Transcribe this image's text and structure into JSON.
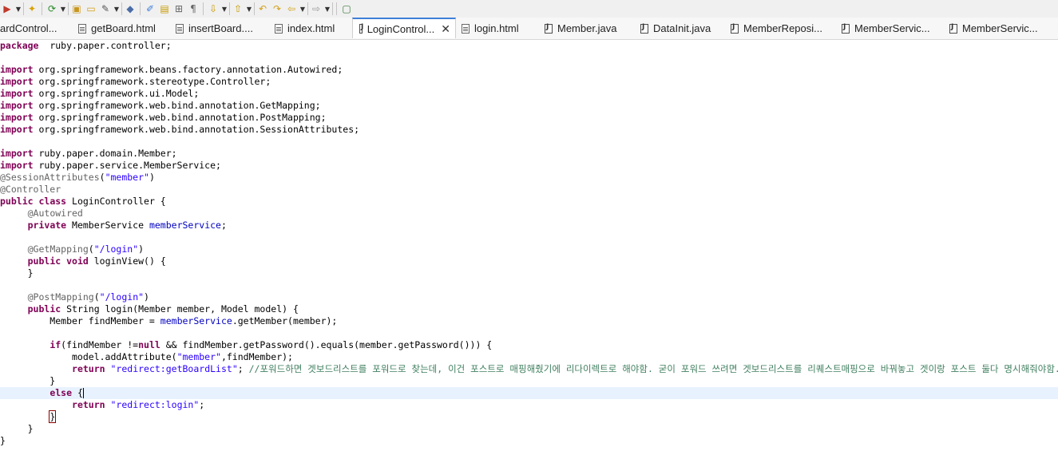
{
  "toolbar": {
    "buttons": [
      {
        "name": "run-icon",
        "glyph": "▶",
        "color": "#c0392b"
      },
      {
        "name": "package-icon",
        "glyph": "✦",
        "color": "#d9a000"
      },
      {
        "name": "refresh-icon",
        "glyph": "⟳",
        "color": "#2a8a2a"
      },
      {
        "name": "open-folder-icon",
        "glyph": "▣",
        "color": "#c8961e"
      },
      {
        "name": "folder-icon",
        "glyph": "▭",
        "color": "#d4a017"
      },
      {
        "name": "wand-icon",
        "glyph": "✎",
        "color": "#555555"
      },
      {
        "name": "toggle-mark-icon",
        "glyph": "◆",
        "color": "#4a6da7"
      },
      {
        "name": "highlight-icon",
        "glyph": "✐",
        "color": "#3f7fd8"
      },
      {
        "name": "block-selection-icon",
        "glyph": "▤",
        "color": "#c89b00"
      },
      {
        "name": "show-whitespace-icon",
        "glyph": "⊞",
        "color": "#666666"
      },
      {
        "name": "paragraph-icon",
        "glyph": "¶",
        "color": "#666666"
      },
      {
        "name": "next-annotation-icon",
        "glyph": "⇩",
        "color": "#c89b00"
      },
      {
        "name": "prev-annotation-icon",
        "glyph": "⇧",
        "color": "#c89b00"
      },
      {
        "name": "last-edit-icon",
        "glyph": "↶",
        "color": "#d4a017"
      },
      {
        "name": "last-edit-forward-icon",
        "glyph": "↷",
        "color": "#d4a017"
      },
      {
        "name": "back-icon",
        "glyph": "⇦",
        "color": "#d4a017"
      },
      {
        "name": "forward-icon",
        "glyph": "⇨",
        "color": "#999999"
      },
      {
        "name": "maximize-icon",
        "glyph": "▢",
        "color": "#3a7a3a"
      }
    ]
  },
  "tabs": [
    {
      "label": "ardControl...",
      "icon": "java",
      "active": false
    },
    {
      "label": "getBoard.html",
      "icon": "html",
      "active": false
    },
    {
      "label": "insertBoard....",
      "icon": "html",
      "active": false
    },
    {
      "label": "index.html",
      "icon": "html",
      "active": false
    },
    {
      "label": "LoginControl...",
      "icon": "java",
      "active": true,
      "close": "✕"
    },
    {
      "label": "login.html",
      "icon": "html",
      "active": false
    },
    {
      "label": "Member.java",
      "icon": "java",
      "active": false
    },
    {
      "label": "DataInit.java",
      "icon": "java",
      "active": false
    },
    {
      "label": "MemberReposi...",
      "icon": "java",
      "active": false
    },
    {
      "label": "MemberServic...",
      "icon": "java",
      "active": false
    },
    {
      "label": "MemberServic...",
      "icon": "java",
      "active": false
    }
  ],
  "code": [
    [
      [
        "kw",
        "package"
      ],
      [
        "",
        "  ruby.paper.controller;"
      ]
    ],
    [],
    [
      [
        "kw",
        "import"
      ],
      [
        "",
        " org.springframework.beans.factory.annotation.Autowired;"
      ]
    ],
    [
      [
        "kw",
        "import"
      ],
      [
        "",
        " org.springframework.stereotype.Controller;"
      ]
    ],
    [
      [
        "kw",
        "import"
      ],
      [
        "",
        " org.springframework.ui.Model;"
      ]
    ],
    [
      [
        "kw",
        "import"
      ],
      [
        "",
        " org.springframework.web.bind.annotation.GetMapping;"
      ]
    ],
    [
      [
        "kw",
        "import"
      ],
      [
        "",
        " org.springframework.web.bind.annotation.PostMapping;"
      ]
    ],
    [
      [
        "kw",
        "import"
      ],
      [
        "",
        " org.springframework.web.bind.annotation.SessionAttributes;"
      ]
    ],
    [],
    [
      [
        "kw",
        "import"
      ],
      [
        "",
        " ruby.paper.domain.Member;"
      ]
    ],
    [
      [
        "kw",
        "import"
      ],
      [
        "",
        " ruby.paper.service.MemberService;"
      ]
    ],
    [
      [
        "ann",
        "@SessionAttributes"
      ],
      [
        "",
        "("
      ],
      [
        "str",
        "\"member\""
      ],
      [
        "",
        ")"
      ]
    ],
    [
      [
        "ann",
        "@Controller"
      ]
    ],
    [
      [
        "kw",
        "public"
      ],
      [
        "",
        " "
      ],
      [
        "kw",
        "class"
      ],
      [
        "",
        " LoginController {"
      ]
    ],
    [
      [
        "",
        "     "
      ],
      [
        "ann",
        "@Autowired"
      ]
    ],
    [
      [
        "",
        "     "
      ],
      [
        "kw",
        "private"
      ],
      [
        "",
        " MemberService "
      ],
      [
        "fld",
        "memberService"
      ],
      [
        "",
        ";"
      ]
    ],
    [],
    [
      [
        "",
        "     "
      ],
      [
        "ann",
        "@GetMapping"
      ],
      [
        "",
        "("
      ],
      [
        "str",
        "\"/login\""
      ],
      [
        "",
        ")"
      ]
    ],
    [
      [
        "",
        "     "
      ],
      [
        "kw",
        "public"
      ],
      [
        "",
        " "
      ],
      [
        "kw",
        "void"
      ],
      [
        "",
        " loginView() {"
      ]
    ],
    [
      [
        "",
        "     }"
      ]
    ],
    [],
    [
      [
        "",
        "     "
      ],
      [
        "ann",
        "@PostMapping"
      ],
      [
        "",
        "("
      ],
      [
        "str",
        "\"/login\""
      ],
      [
        "",
        ")"
      ]
    ],
    [
      [
        "",
        "     "
      ],
      [
        "kw",
        "public"
      ],
      [
        "",
        " String login(Member member, Model model) {"
      ]
    ],
    [
      [
        "",
        "         Member findMember = "
      ],
      [
        "fld",
        "memberService"
      ],
      [
        "",
        ".getMember(member);"
      ]
    ],
    [],
    [
      [
        "",
        "         "
      ],
      [
        "kw",
        "if"
      ],
      [
        "",
        "(findMember !="
      ],
      [
        "kw",
        "null"
      ],
      [
        "",
        " && findMember.getPassword().equals(member.getPassword())) {"
      ]
    ],
    [
      [
        "",
        "             model.addAttribute("
      ],
      [
        "str",
        "\"member\""
      ],
      [
        "",
        ",findMember);"
      ]
    ],
    [
      [
        "",
        "             "
      ],
      [
        "kw",
        "return"
      ],
      [
        "",
        " "
      ],
      [
        "str",
        "\"redirect:getBoardList\""
      ],
      [
        "",
        "; "
      ],
      [
        "cmt",
        "//포워드하면 겟보드리스트를 포워드로 찾는데, 이건 포스트로 매핑해줬기에 리다이렉트로 해야함. 굳이 포워드 쓰려면 겟보드리스트를 리퀘스트매핑으로 바꿔놓고 겟이랑 포스트 둘다 명시해줘야함."
      ]
    ],
    [
      [
        "",
        "         }"
      ]
    ],
    [
      [
        "",
        "         "
      ],
      [
        "kw",
        "else"
      ],
      [
        "",
        " {"
      ],
      [
        "caret",
        ""
      ]
    ],
    [
      [
        "",
        "             "
      ],
      [
        "kw",
        "return"
      ],
      [
        "",
        " "
      ],
      [
        "str",
        "\"redirect:login\""
      ],
      [
        "",
        ";"
      ]
    ],
    [
      [
        "",
        "         "
      ],
      [
        "bracket",
        "}"
      ]
    ],
    [
      [
        "",
        "     }"
      ]
    ],
    [
      [
        "",
        "}"
      ]
    ]
  ],
  "current_line": 29
}
